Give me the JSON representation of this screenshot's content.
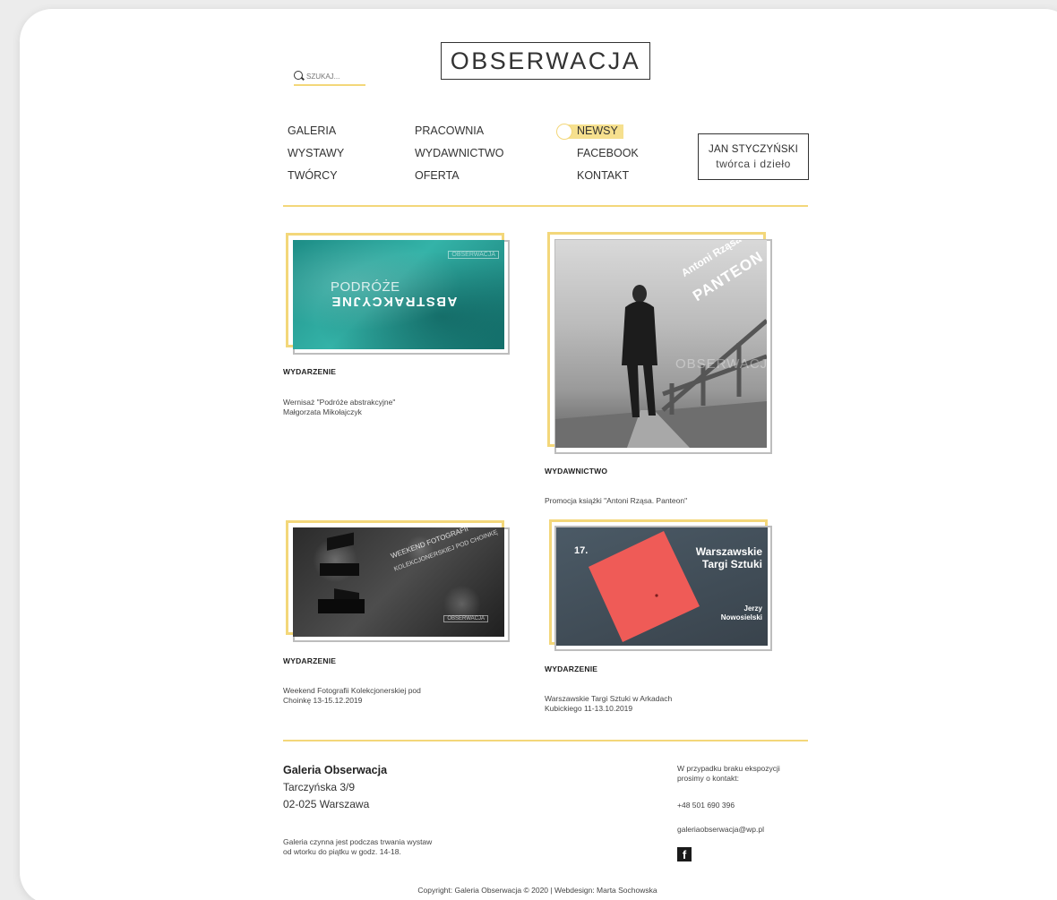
{
  "header": {
    "search_placeholder": "SZUKAJ...",
    "logo": "OBSERWACJA"
  },
  "nav": {
    "col1": [
      "GALERIA",
      "WYSTAWY",
      "TWÓRCY"
    ],
    "col2": [
      "PRACOWNIA",
      "WYDAWNICTWO",
      "OFERTA"
    ],
    "col3": [
      "NEWSY",
      "FACEBOOK",
      "KONTAKT"
    ],
    "active": "NEWSY",
    "author_name": "JAN STYCZYŃSKI",
    "author_sub": "twórca i dzieło"
  },
  "cards": [
    {
      "category": "WYDARZENIE",
      "desc_line1": "Wernisaż \"Podróże abstrakcyjne\"",
      "desc_line2": "Małgorzata Mikołajczyk",
      "img_text1": "PODRÓŻE",
      "img_text2": "ABSTRAKCYJNE",
      "img_mark": "OBSERWACJA"
    },
    {
      "category": "WYDAWNICTWO",
      "desc_line1": "Promocja książki \"Antoni Rząsa. Panteon\"",
      "desc_line2": "",
      "img_text1": "Antoni Rząsa",
      "img_text2": "PANTEON",
      "img_mark": "OBSERWACJA"
    },
    {
      "category": "WYDARZENIE",
      "desc_line1": "Weekend Fotografii Kolekcjonerskiej pod",
      "desc_line2": "Choinkę 13-15.12.2019",
      "img_text1": "WEEKEND FOTOGRAFII",
      "img_text2": "KOLEKCJONERSKIEJ POD CHOINKĘ",
      "img_mark": "OBSERWACJA"
    },
    {
      "category": "WYDARZENIE",
      "desc_line1": "Warszawskie Targi Sztuki w Arkadach",
      "desc_line2": "Kubickiego 11-13.10.2019",
      "img_text1": "17.",
      "img_text2": "Warszawskie Targi Sztuki",
      "img_mark": "Jerzy Nowosielski"
    }
  ],
  "footer": {
    "title": "Galeria Obserwacja",
    "address1": "Tarczyńska 3/9",
    "address2": "02-025 Warszawa",
    "hours1": "Galeria czynna jest podczas trwania wystaw",
    "hours2": "od wtorku do piątku w godz. 14-18.",
    "contact1": "W przypadku braku ekspozycji",
    "contact2": "prosimy o kontakt:",
    "phone": "+48 501 690 396",
    "email": "galeriaobserwacja@wp.pl",
    "fb_icon": "f",
    "copyright": "Copyright: Galeria Obserwacja © 2020 | Webdesign: Marta Sochowska"
  },
  "colors": {
    "accent": "#f3d77a",
    "text": "#2b2b2b"
  }
}
